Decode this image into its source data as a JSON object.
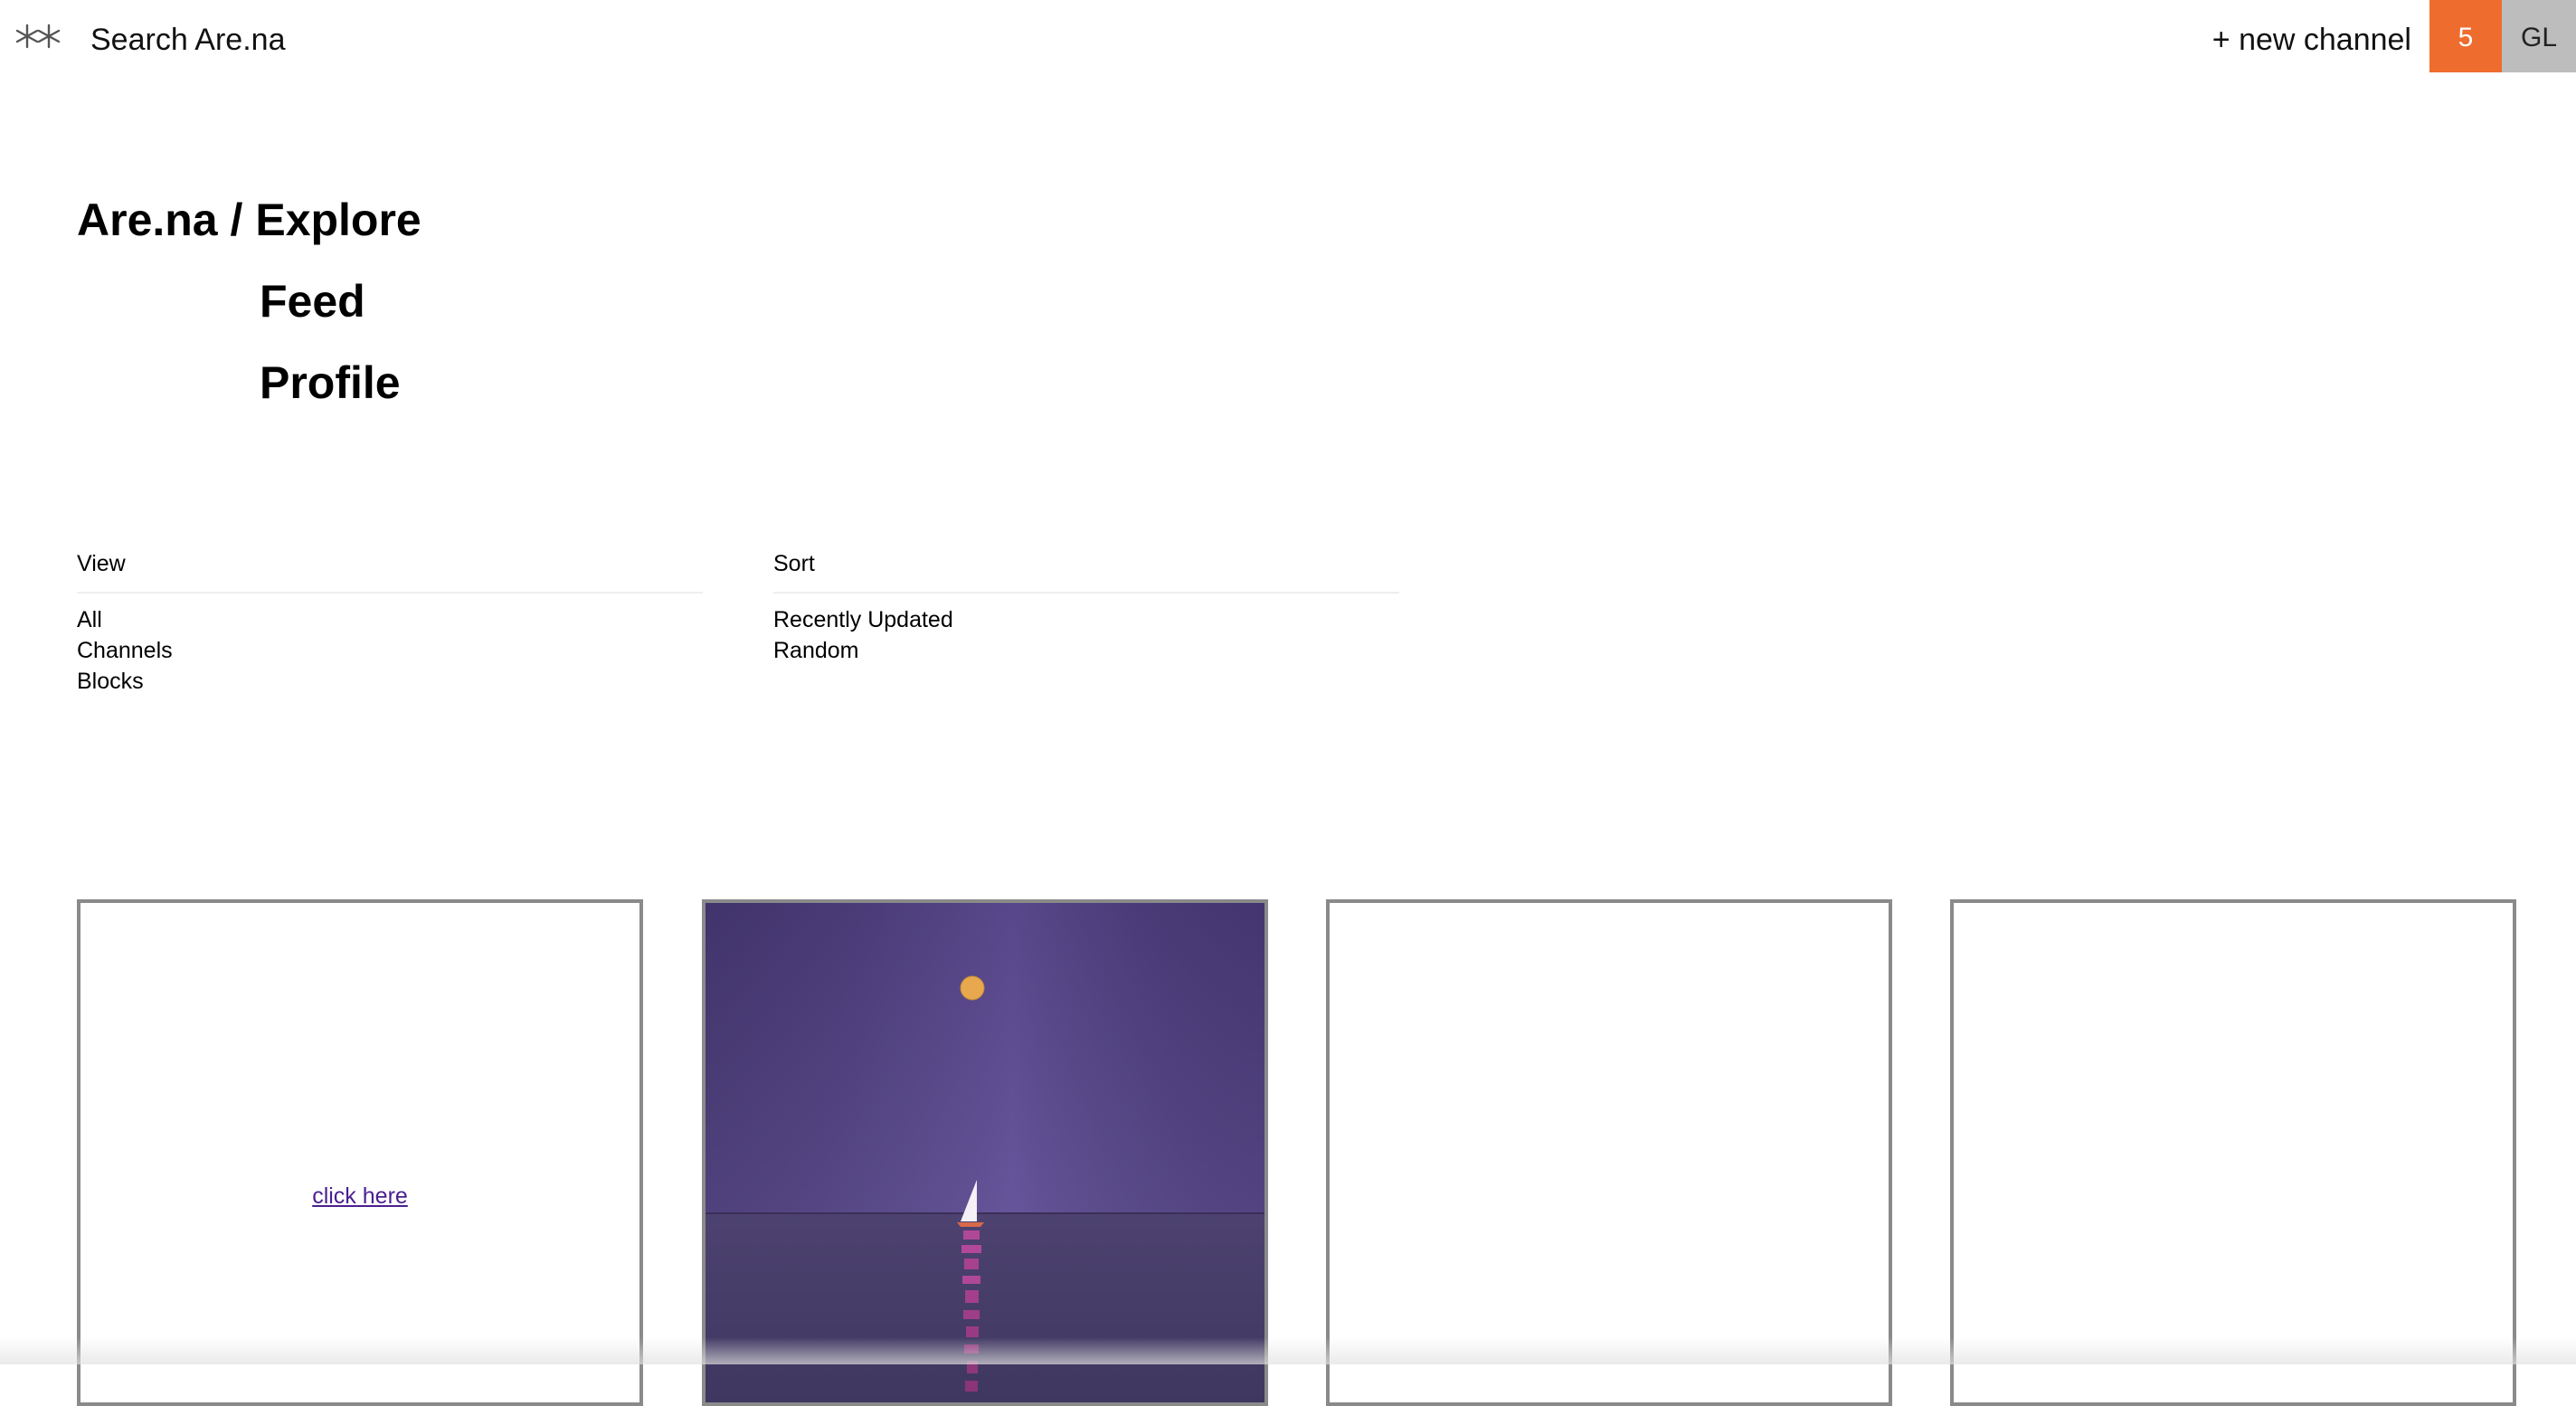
{
  "header": {
    "logo_icon": "arena-logo-icon",
    "search_label": "Search Are.na",
    "new_channel_label": "+ new channel",
    "notification_count": "5",
    "notification_color": "#ee6c2d",
    "avatar_initials": "GL",
    "avatar_color": "#bdbdbd"
  },
  "nav": {
    "home": "Are.na",
    "separator": "/",
    "explore": "Explore",
    "feed": "Feed",
    "profile": "Profile"
  },
  "filters": {
    "view": {
      "title": "View",
      "options": [
        "All",
        "Channels",
        "Blocks"
      ]
    },
    "sort": {
      "title": "Sort",
      "options": [
        "Recently Updated",
        "Random"
      ]
    }
  },
  "blocks": [
    {
      "type": "link",
      "text": "click here"
    },
    {
      "type": "image",
      "description_icon": "sailboat-moon-image"
    },
    {
      "type": "empty"
    },
    {
      "type": "empty"
    }
  ]
}
